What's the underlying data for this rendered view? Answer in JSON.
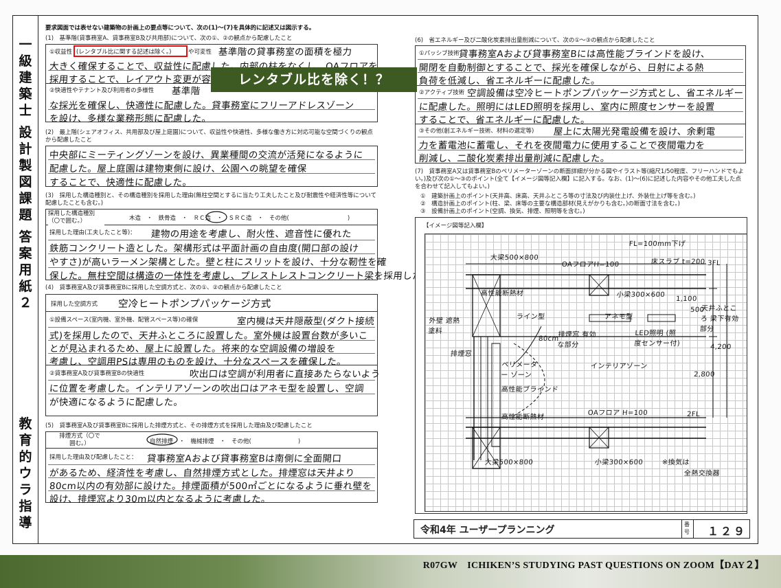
{
  "document": {
    "header_note": "要求図面では表せない建築物の計画上の要点等について、次の(1)～(7)を具体的に記述又は図示する。",
    "vertical_title_top": [
      "一",
      "級",
      "建",
      "築",
      "士",
      "設",
      "計",
      "製",
      "図",
      "課",
      "題",
      "答",
      "案",
      "用",
      "紙",
      "２"
    ],
    "vertical_title_bottom": [
      "教",
      "育",
      "的",
      "ウ",
      "ラ",
      "指",
      "導"
    ]
  },
  "banner": {
    "text": "レンタブル比を除く！？"
  },
  "sections": {
    "s1": {
      "title": "(1)　基準階(貸事務室A、貸事務室B及び共用部)について、次の①、②の観点から配慮したこと",
      "row1_label": "①収益性",
      "row1_highlight": "(レンタブル比に関する記述は除く。)",
      "row1_label_tail": "や可変性",
      "row1_lines": [
        "基準階の貸事務室の面積を極力",
        "大きく確保することで、収益性に配慮した。内部の柱をなくし、OAフロアを",
        "採用することで、レイアウト変更が容易"
      ],
      "row2_label": "②快適性やテナント及び利用者の多様性",
      "row2_lines": [
        "基準階",
        "な採光を確保し、快適性に配慮した。貸事務室にフリーアドレスゾーン",
        "を設け、多様な業務形態に配慮した。"
      ]
    },
    "s2": {
      "title": "(2)　最上階(シェアオフィス、共用部及び屋上庭園)について、収益性や快適性、多様な働き方に対応可能な空間づくりの観点から配慮したこと",
      "lines": [
        "中央部にミーティングゾーンを設け、異業種間の交流が活発になるように",
        "配慮した。屋上庭園は建物東側に設け、公園への眺望を確保",
        "することで、快適性に配慮した。"
      ]
    },
    "s3": {
      "title": "(3)　採用した構造種別と、その構造種別を採用した理由(無柱空間とするに当たり工夫したこと及び耐震性や経済性等について配慮したことも含む。)",
      "struct_label": "採用した構造種別（〇で囲む。）",
      "struct_options": "木造　・　鉄骨造　・　ＲＣ造　・　ＳＲＣ造　・　その他(　　　　　　　　　　)",
      "reason_label": "採用した理由(工夫したこと等)：",
      "lines": [
        "建物の用途を考慮し、耐火性、遮音性に優れた",
        "鉄筋コンクリート造とした。架構形式は平面計画の自由度(開口部の設け",
        "やすさ)が高いラーメン架構とした。壁と柱にスリットを設け、十分な靭性を確",
        "保した。無柱空間は構造の一体性を考慮し、プレストレストコンクリート梁を採用した。"
      ]
    },
    "s4": {
      "title": "(4)　貸事務室A及び貸事務室Bに採用した空調方式と、次の①、②の観点から配慮したこと",
      "ac_label": "採用した空調方式",
      "ac_value": "空冷ヒートポンプパッケージ方式",
      "row1_label": "①設備スペース(室内機、室外機、配管スペース等)の確保",
      "row1_lines": [
        "室内機は天井隠蔽型(ダクト接続",
        "式)を採用したので、天井ふところに設置した。室外機は設置台数が多いこ",
        "とが見込まれるため、屋上に設置した。将来的な空調設備の増設を",
        "考慮し、空調用PSは専用のものを設け、十分なスペースを確保した。"
      ],
      "row2_label": "②貸事務室A及び貸事務室Bの快適性",
      "row2_lines": [
        "吹出口は空調が利用者に直接あたらないよう",
        "に位置を考慮した。インテリアゾーンの吹出口はアネモ型を設置し、空調",
        "が快適になるように配慮した。"
      ]
    },
    "s5": {
      "title": "(5)　貸事務室A及び貸事務室Bに採用した排煙方式と、その排煙方式を採用した理由及び配慮したこと",
      "method_label": "排煙方式（〇で囲む。）",
      "method_options": "自然排煙　・　機械排煙　・　その他(　　　　　　　　)",
      "reason_label": "採用した理由及び配慮したこと：",
      "lines": [
        "貸事務室Aおよび貸事務室Bは南側に全面開口",
        "があるため、経済性を考慮し、自然排煙方式とした。排煙窓は天井より",
        "80cm以内の有効部に設けた。排煙面積が500㎡ごとになるように垂れ壁を",
        "設け、排煙窓より30m以内となるように考慮した。"
      ]
    },
    "s6": {
      "title": "(6)　省エネルギー及び二酸化炭素排出量削減について、次の①～③の観点から配慮したこと",
      "row1_label": "①パッシブ技術",
      "row1_lines": [
        "貸事務室Aおよび貸事務室Bには高性能ブラインドを設け、",
        "開閉を自動制御とすることで、採光を確保しながら、日射による熱",
        "負荷を低減し、省エネルギーに配慮した。"
      ],
      "row2_label": "②アクティブ技術",
      "row2_lines": [
        "空調設備は空冷ヒートポンプパッケージ方式とし、省エネルギー",
        "に配慮した。照明にはLED照明を採用し、室内に照度センサーを設置",
        "することで、省エネルギーに配慮した。"
      ],
      "row3_label": "③その他(創エネルギー技術、材料の選定等)",
      "row3_lines": [
        "屋上に太陽光発電設備を設け、余剰電",
        "力を蓄電池に蓄電し、それを夜間電力に使用することで夜間電力を",
        "削減し、二酸化炭素排出量削減に配慮した。"
      ]
    },
    "s7": {
      "title": "(7)　貸事務室A又は貸事務室Bのペリメーターゾーンの断面詳細が分かる図やイラスト等(縮尺1/50程度、フリーハンドでもよい。)及び次の①～③のポイント(全て【イメージ図等記入欄】に記入する。なお、(1)～(6)に記述した内容やその他工夫した点を合わせて記入してもよい。)",
      "points": [
        "①　建築計画上のポイント(天井高、床高、天井ふところ等の寸法及び内装仕上げ、外装仕上げ等を含む。)",
        "②　構造計画上のポイント(柱、梁、床等の主要な構造部材(見えがかりも含む。)の断面寸法を含む。)",
        "③　設備計画上のポイント(空調、換気、排煙、照明等を含む。)"
      ],
      "image_label": "【イメージ図等記入欄】",
      "drawing_labels": [
        "FL=100mm下げ",
        "大梁500×800",
        "OAフロアH=100",
        "床スラブ t=200",
        "3FL",
        "高性能断熱材",
        "小梁300×600",
        "1,100",
        "500",
        "天井ふところ 梁下有効部分",
        "外壁 遮熱塗料",
        "ライン型",
        "アネモ型",
        "排煙窓 有効な部分",
        "LED照明 (照度センサー付)",
        "80cm",
        "4,200",
        "排煙窓",
        "ペリメーター ゾーン",
        "インテリアゾーン",
        "2,800",
        "高性能ブラインド",
        "高性能断熱材",
        "OAフロア H=100",
        "2FL",
        "大梁500×800",
        "小梁300×600",
        "※換気は",
        "全熱交換器"
      ]
    }
  },
  "footer": {
    "plan_title": "令和4年 ユーザープランニング",
    "number_label": "番号",
    "number": "１２９"
  },
  "bottom_bar": {
    "text": "R07GW　ICHIKEN’S STUDYING PAST QUESTIONS ON ZOOM【DAY２】"
  }
}
